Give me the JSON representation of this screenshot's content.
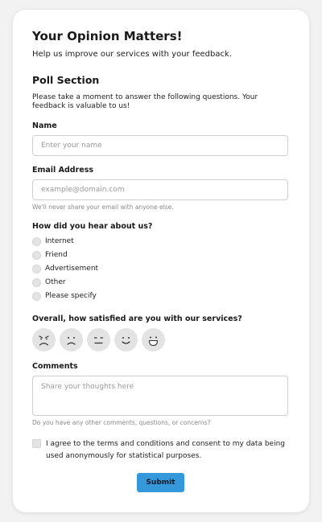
{
  "header": {
    "title": "Your Opinion Matters!",
    "subtitle": "Help us improve our services with your feedback."
  },
  "poll": {
    "section_title": "Poll Section",
    "intro": "Please take a moment to answer the following questions. Your feedback is valuable to us!"
  },
  "form": {
    "name": {
      "label": "Name",
      "placeholder": "Enter your name",
      "value": ""
    },
    "email": {
      "label": "Email Address",
      "placeholder": "example@domain.com",
      "value": "",
      "help": "We'll never share your email with anyone else."
    },
    "source": {
      "label": "How did you hear about us?",
      "options": [
        "Internet",
        "Friend",
        "Advertisement",
        "Other",
        "Please specify"
      ]
    },
    "satisfaction": {
      "label": "Overall, how satisfied are you with our services?",
      "faces": [
        "very-dissatisfied-icon",
        "dissatisfied-icon",
        "neutral-icon",
        "satisfied-icon",
        "very-satisfied-icon"
      ]
    },
    "comments": {
      "label": "Comments",
      "placeholder": "Share your thoughts here",
      "help": "Do you have any other comments, questions, or concerns?"
    },
    "consent": {
      "text": "I agree to the terms and conditions and consent to my data being used anonymously for statistical purposes.",
      "checked": false
    },
    "submit_label": "Submit"
  },
  "colors": {
    "accent": "#3498db",
    "background": "#f2f2f2",
    "card": "#ffffff"
  }
}
